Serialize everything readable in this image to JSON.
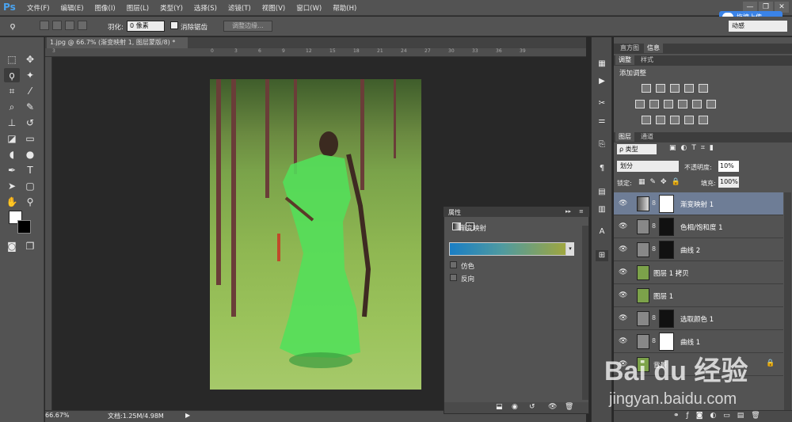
{
  "app": {
    "logo": "Ps"
  },
  "menu": [
    "文件(F)",
    "编辑(E)",
    "图像(I)",
    "图层(L)",
    "类型(Y)",
    "选择(S)",
    "滤镜(T)",
    "视图(V)",
    "窗口(W)",
    "帮助(H)"
  ],
  "window_controls": [
    "—",
    "❐",
    "✕"
  ],
  "upload_badge": "拖拽上传",
  "options_bar": {
    "feather_label": "羽化:",
    "feather_value": "0 像素",
    "antialias_label": "消除锯齿",
    "refine_edge": "调整边缘...",
    "workspace": "动感"
  },
  "document": {
    "tab": "1.jpg @ 66.7% (渐变映射 1, 图层蒙版/8) *",
    "zoom": "66.67%",
    "doc_size": "文档:1.25M/4.98M",
    "ruler_marks": [
      "3",
      "0",
      "3",
      "6",
      "9",
      "12",
      "15",
      "18",
      "21",
      "24",
      "27",
      "30",
      "33",
      "36",
      "39"
    ]
  },
  "properties": {
    "title": "属性",
    "type_label": "渐变映射",
    "gradient_colors": [
      "#1a7ec5",
      "#4f9aa0",
      "#9fa640"
    ],
    "dither_label": "仿色",
    "reverse_label": "反向"
  },
  "panels": {
    "histogram_tab": "直方图",
    "info_tab": "信息",
    "adjustments_tab": "调整",
    "styles_tab": "样式",
    "adjustments_title": "添加调整",
    "layers_tab": "图层",
    "channels_tab": "通道",
    "kind_filter": "ρ 类型",
    "blend_mode": "划分",
    "opacity_label": "不透明度:",
    "opacity_value": "10%",
    "lock_label": "锁定:",
    "fill_label": "填充:",
    "fill_value": "100%"
  },
  "layers": [
    {
      "name": "渐变映射 1",
      "selected": true,
      "kind": "gradient-map",
      "has_mask": true
    },
    {
      "name": "色相/饱和度 1",
      "selected": false,
      "kind": "hue-saturation",
      "has_mask": true
    },
    {
      "name": "曲线 2",
      "selected": false,
      "kind": "curves",
      "has_mask": true
    },
    {
      "name": "图层 1 拷贝",
      "selected": false,
      "kind": "pixel",
      "has_mask": false
    },
    {
      "name": "图层 1",
      "selected": false,
      "kind": "pixel",
      "has_mask": false
    },
    {
      "name": "选取颜色 1",
      "selected": false,
      "kind": "selective-color",
      "has_mask": true
    },
    {
      "name": "曲线 1",
      "selected": false,
      "kind": "curves",
      "has_mask": true
    },
    {
      "name": "背景",
      "selected": false,
      "kind": "pixel",
      "has_mask": false
    }
  ],
  "watermark": {
    "brand": "Bai du 经验",
    "url": "jingyan.baidu.com"
  }
}
